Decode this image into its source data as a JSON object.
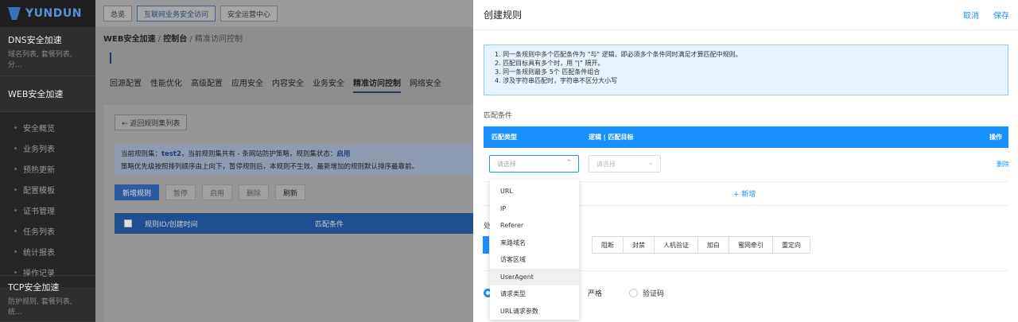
{
  "sidebar": {
    "logo": "YUNDUN",
    "dns": {
      "title": "DNS安全加速",
      "sub": "域名列表, 套餐列表, 分..."
    },
    "web": "WEB安全加速",
    "items": [
      "安全概览",
      "业务列表",
      "预热更新",
      "配置模板",
      "证书管理",
      "任务列表",
      "统计报表",
      "操作记录"
    ],
    "tcp": {
      "title": "TCP安全加速",
      "sub": "防护规则, 套餐列表, 统..."
    }
  },
  "topbar": {
    "items": [
      "总览",
      "互联网业务安全访问",
      "安全运营中心"
    ]
  },
  "breadcrumb": {
    "a": "WEB安全加速",
    "sep1": "/",
    "b": "控制台",
    "sep2": "/",
    "c": "精准访问控制"
  },
  "tabs": [
    "回源配置",
    "性能优化",
    "高级配置",
    "应用安全",
    "内容安全",
    "业务安全",
    "精准访问控制",
    "网络安全"
  ],
  "main": {
    "back": "← 返回规则集列表",
    "notice_line1_prefix": "当前规则集：",
    "notice_name": "test2",
    "notice_line1_mid": "，当前规则集共有 - 条网站防护策略，规则集状态：",
    "notice_status": "启用",
    "notice_line2": "策略优先级按照排列顺序由上向下，暂停规则后，本规则不生效。最新增加的规则默认排序最靠前。",
    "buttons": [
      "新增规则",
      "暂停",
      "启用",
      "删除",
      "刷新"
    ],
    "thead": [
      "规则ID/创建时间",
      "匹配条件"
    ]
  },
  "drawer": {
    "title": "创建规则",
    "cancel": "取消",
    "save": "保存",
    "info": [
      "1. 同一条规则中多个匹配条件为 \"与\" 逻辑，即必须多个条件同时满足才算匹配中规则。",
      "2. 匹配目标具有多个时，用 \"|\" 隔开。",
      "3. 同一条规则最多 5个 匹配条件组合",
      "4. 涉及字符串匹配时，字符串不区分大小写"
    ],
    "match_label": "匹配条件",
    "thead": {
      "c1": "匹配类型",
      "c2": "逻辑 | 匹配目标",
      "c3": "操作"
    },
    "select1_placeholder": "请选择",
    "select2_placeholder": "请选择",
    "delete": "删除",
    "add": "+ 新增",
    "action_label": "处",
    "actions": [
      "阻断",
      "封禁",
      "人机验证",
      "加白",
      "蜜网牵引",
      "重定向"
    ],
    "radio1": "严格",
    "radio2": "验证码"
  },
  "dropdown": {
    "options": [
      "URL",
      "IP",
      "Referer",
      "来路域名",
      "访客区域",
      "UserAgent",
      "请求类型",
      "URL请求参数"
    ],
    "hovered": 5
  }
}
